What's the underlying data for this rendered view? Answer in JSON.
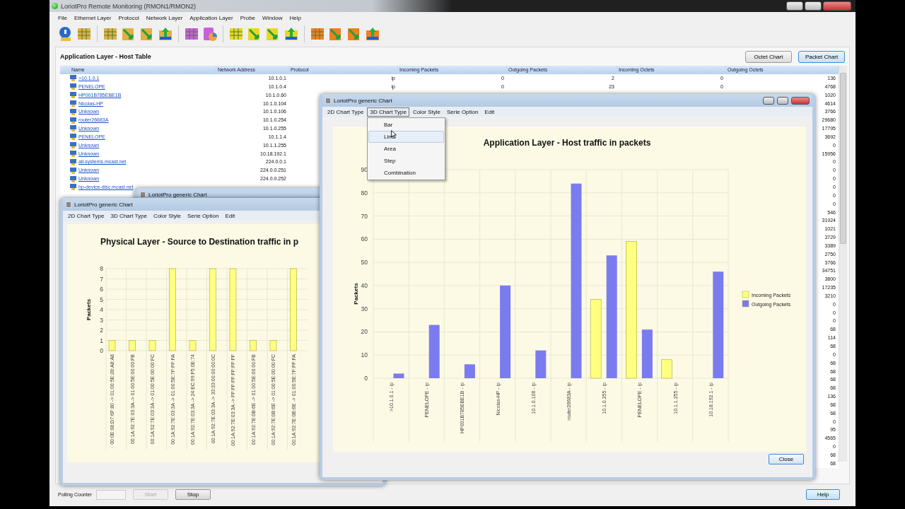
{
  "window": {
    "title": "LoriotPro Remote Monitoring (RMON1/RMON2)"
  },
  "menu": [
    "File",
    "Ethernet Layer",
    "Protocol",
    "Network Layer",
    "Application Layer",
    "Probe",
    "Window",
    "Help"
  ],
  "panel": {
    "title": "Application Layer - Host Table",
    "chart_buttons": [
      {
        "label": "Octet Chart",
        "selected": false
      },
      {
        "label": "Packet Chart",
        "selected": true
      }
    ]
  },
  "table": {
    "columns": [
      "Name",
      "Network Address",
      "Protocol",
      "Incoming Packets",
      "Outgoing Packets",
      "Incoming Octets",
      "Outgoing Octets"
    ],
    "rows": [
      {
        "name": ">10.1.0.1",
        "address": "10.1.0.1",
        "protocol": "ip",
        "in_packets": "0",
        "out_packets": "2",
        "in_octets": "0",
        "out_octets": "136"
      },
      {
        "name": "PENELOPE",
        "address": "10.1.0.4",
        "protocol": "ip",
        "in_packets": "0",
        "out_packets": "23",
        "in_octets": "0",
        "out_octets": "4768"
      },
      {
        "name": "HP001B785EBE1B",
        "address": "10.1.0.60",
        "out_octets": "1020"
      },
      {
        "name": "Nicolas-HP",
        "address": "10.1.0.104",
        "out_octets": "4614"
      },
      {
        "name": "Unknown",
        "address": "10.1.0.106",
        "out_octets": "3766"
      },
      {
        "name": "router26683A",
        "address": "10.1.0.254",
        "out_octets": "29680"
      },
      {
        "name": "Unknown",
        "address": "10.1.0.255",
        "out_octets": "17795"
      },
      {
        "name": "PENELOPE",
        "address": "10.1.1.4",
        "out_octets": "3692"
      },
      {
        "name": "Unknown",
        "address": "10.1.1.255",
        "out_octets": "0"
      },
      {
        "name": "Unknown",
        "address": "10.18.192.1",
        "out_octets": "15956"
      },
      {
        "name": "all-systems.mcast.net",
        "address": "224.0.0.1",
        "out_octets": "0"
      },
      {
        "name": "Unknown",
        "address": "224.0.0.251",
        "out_octets": "0"
      },
      {
        "name": "Unknown",
        "address": "224.0.0.252",
        "out_octets": "0"
      },
      {
        "name": "hp-device-disc.mcast.net",
        "out_octets": "0"
      },
      {
        "out_octets": "0"
      },
      {
        "out_octets": "0"
      },
      {
        "out_octets": "546"
      },
      {
        "out_octets": "31924"
      },
      {
        "out_octets": "1021"
      },
      {
        "out_octets": "3729"
      },
      {
        "out_octets": "3389"
      },
      {
        "out_octets": "2750"
      },
      {
        "out_octets": "3766"
      },
      {
        "out_octets": "34751"
      },
      {
        "out_octets": "3800"
      },
      {
        "out_octets": "17235"
      },
      {
        "out_octets": "3210"
      },
      {
        "out_octets": "0"
      },
      {
        "out_octets": "0"
      },
      {
        "out_octets": "0"
      },
      {
        "out_octets": "68"
      },
      {
        "out_octets": "114"
      },
      {
        "out_octets": "68"
      },
      {
        "out_octets": "0"
      },
      {
        "out_octets": "68"
      },
      {
        "out_octets": "68"
      },
      {
        "out_octets": "68"
      },
      {
        "out_octets": "68"
      },
      {
        "out_octets": "136"
      },
      {
        "out_octets": "68"
      },
      {
        "out_octets": "68"
      },
      {
        "out_octets": "0"
      },
      {
        "out_octets": "95"
      },
      {
        "out_octets": "4565"
      },
      {
        "out_octets": "0"
      },
      {
        "out_octets": "68"
      },
      {
        "out_octets": "68"
      }
    ]
  },
  "hidden_chart_window": {
    "title": "LoriotPro generic Chart"
  },
  "physical_chart_window": {
    "title": "LoriotPro generic Chart",
    "menu": [
      {
        "label": "2D Chart Type",
        "open": false
      },
      {
        "label": "3D Chart Type",
        "open": false
      },
      {
        "label": "Color Style",
        "open": false
      },
      {
        "label": "Serie Option",
        "open": false
      },
      {
        "label": "Edit",
        "open": false
      }
    ],
    "chart_data": {
      "type": "bar",
      "title": "Physical Layer - Source to Destination traffic in p",
      "ylabel": "Packets",
      "categories": [
        "00:0E:08:D7:6F:80 -> 01:00:5E:28:A8:A8",
        "00:1A:92:7E:03:3A -> 01:00:5E:00:00:FB",
        "00:1A:92:7E:03:3A -> 01:00:5E:00:00:FC",
        "00:1A:92:7E:03:3A -> 01:00:5E:7F:FF:FA",
        "00:1A:92:7E:03:3A -> 24:EC:99:F5:0E:74",
        "00:1A:92:7E:03:3A -> 33:33:00:00:00:0C",
        "00:1A:92:7E:03:3A -> FF:FF:FF:FF:FF:FF",
        "00:1A:92:7E:0B:6E -> 01:00:5E:00:00:FB",
        "00:1A:92:7E:0B:6E -> 01:00:5E:00:00:FC",
        "00:1A:92:7E:0B:6E -> 01:00:5E:7F:FF:FA"
      ],
      "series": [
        {
          "color": "#ffff80",
          "values": [
            1,
            1,
            1,
            8,
            1,
            8,
            8,
            1,
            1,
            8
          ]
        }
      ],
      "ylim": [
        0,
        8
      ],
      "yticks": [
        0,
        1,
        2,
        3,
        4,
        5,
        6,
        7,
        8
      ],
      "grid": true
    }
  },
  "application_chart_window": {
    "title": "LoriotPro generic Chart",
    "menu": [
      {
        "label": "2D Chart Type",
        "open": false
      },
      {
        "label": "3D Chart Type",
        "open": true
      },
      {
        "label": "Color Style",
        "open": false
      },
      {
        "label": "Serie Option",
        "open": false
      },
      {
        "label": "Edit",
        "open": false
      }
    ],
    "open_menu": [
      {
        "label": "Bar",
        "selected": false
      },
      {
        "label": "Line",
        "selected": true
      },
      {
        "label": "Area",
        "selected": false
      },
      {
        "label": "Step",
        "selected": false
      },
      {
        "label": "Combination",
        "selected": false
      }
    ],
    "chart_data": {
      "type": "bar",
      "title": "Application Layer - Host traffic in packets",
      "ylabel": "Packets",
      "categories": [
        ">10.1.0.1 - ip",
        "PENELOPE - ip",
        "HP001B785EBE1B - ip",
        "Nicolas-HP - ip",
        "10.1.0.106 - ip",
        "router26683A - ip",
        "10.1.0.255 - ip",
        "PENELOPE - ip",
        "10.1.1.255 - ip",
        "10.18.192.1 - ip"
      ],
      "series": [
        {
          "name": "Incoming Packets",
          "color": "#ffff80",
          "values": [
            0,
            0,
            0,
            0,
            0,
            0,
            34,
            59,
            8,
            0
          ]
        },
        {
          "name": "Outgoing Packets",
          "color": "#7b7bf0",
          "values": [
            2,
            23,
            6,
            40,
            12,
            84,
            53,
            21,
            0,
            46
          ]
        }
      ],
      "ylim": [
        0,
        90
      ],
      "yticks": [
        0,
        10,
        20,
        30,
        40,
        50,
        60,
        70,
        80,
        90
      ],
      "grid": true,
      "legend": "right"
    },
    "close_button": "Close"
  },
  "polling": {
    "label": "Polling Counter"
  },
  "controls": [
    {
      "label": "Start",
      "disabled": true
    },
    {
      "label": "Stop",
      "disabled": false
    }
  ],
  "help_button": "Help"
}
